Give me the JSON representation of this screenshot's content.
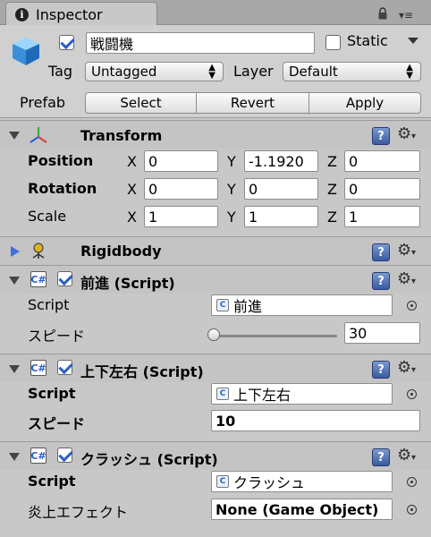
{
  "window": {
    "tab_label": "Inspector"
  },
  "header": {
    "object_name": "戦闘機",
    "static_label": "Static",
    "tag_label": "Tag",
    "tag_value": "Untagged",
    "layer_label": "Layer",
    "layer_value": "Default",
    "prefab_label": "Prefab",
    "select_label": "Select",
    "revert_label": "Revert",
    "apply_label": "Apply",
    "active_checked": true,
    "static_checked": false
  },
  "transform": {
    "title": "Transform",
    "position": {
      "label": "Position",
      "x": "0",
      "y": "-1.1920",
      "z": "0"
    },
    "rotation": {
      "label": "Rotation",
      "x": "0",
      "y": "0",
      "z": "0"
    },
    "scale": {
      "label": "Scale",
      "x": "1",
      "y": "1",
      "z": "1"
    },
    "axis_x": "X",
    "axis_y": "Y",
    "axis_z": "Z"
  },
  "rigidbody": {
    "title": "Rigidbody"
  },
  "script1": {
    "title": "前進 (Script)",
    "script_label": "Script",
    "script_value": "前進",
    "speed_label": "スピード",
    "speed_value": "30",
    "speed_slider_fraction": 0
  },
  "script2": {
    "title": "上下左右 (Script)",
    "script_label": "Script",
    "script_value": "上下左右",
    "speed_label": "スピード",
    "speed_value": "10"
  },
  "script3": {
    "title": "クラッシュ (Script)",
    "script_label": "Script",
    "script_value": "クラッシュ",
    "effect_label": "炎上エフェクト",
    "effect_value": "None (Game Object)"
  },
  "colors": {
    "panel_bg": "#c8c8c8",
    "header_bg": "#c4c4c4",
    "accent_blue": "#2a5ec8"
  }
}
